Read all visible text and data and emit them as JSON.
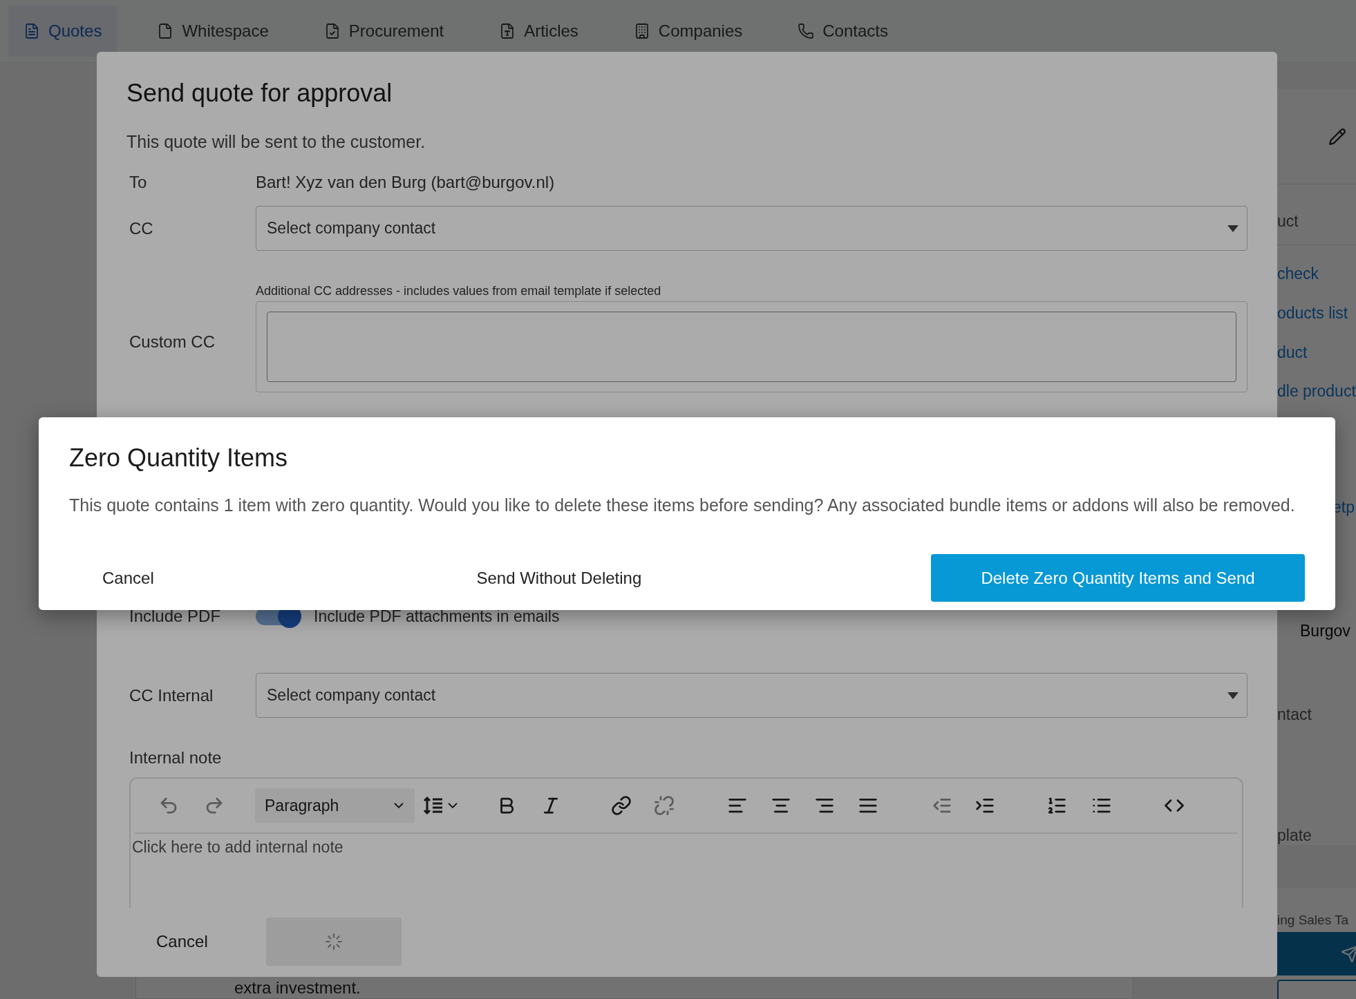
{
  "nav": {
    "tabs": [
      {
        "label": "Quotes",
        "selected": true
      },
      {
        "label": "Whitespace",
        "selected": false
      },
      {
        "label": "Procurement",
        "selected": false
      },
      {
        "label": "Articles",
        "selected": false
      },
      {
        "label": "Companies",
        "selected": false
      },
      {
        "label": "Contacts",
        "selected": false
      }
    ]
  },
  "side_panel": {
    "items": [
      {
        "kind": "text",
        "text": "uct"
      },
      {
        "kind": "link",
        "text": "check"
      },
      {
        "kind": "link",
        "text": "oducts list"
      },
      {
        "kind": "link",
        "text": "duct"
      },
      {
        "kind": "link",
        "text": "dle product"
      },
      {
        "kind": "link",
        "text": "etp"
      },
      {
        "kind": "value",
        "text": "Burgov"
      },
      {
        "kind": "label",
        "text": "ntact"
      },
      {
        "kind": "label",
        "text": "plate"
      }
    ],
    "footer_text": "ing Sales Ta"
  },
  "main_card": {
    "text": "extra investment."
  },
  "approval_dialog": {
    "title": "Send quote for approval",
    "description": "This quote will be sent to the customer.",
    "to": {
      "label": "To",
      "value": "Bart! Xyz van den Burg (bart@burgov.nl)"
    },
    "cc": {
      "label": "CC",
      "placeholder": "Select company contact"
    },
    "custom_cc": {
      "label": "Custom CC",
      "hint": "Additional CC addresses - includes values from email template if selected"
    },
    "include_pdf": {
      "label": "Include PDF",
      "text": "Include PDF attachments in emails",
      "on": true
    },
    "cc_internal": {
      "label": "CC Internal",
      "placeholder": "Select company contact"
    },
    "internal_note": {
      "label": "Internal note",
      "block_format": "Paragraph",
      "placeholder": "Click here to add internal note"
    },
    "footer": {
      "cancel": "Cancel",
      "submit_loading": true
    }
  },
  "zero_quantity_dialog": {
    "title": "Zero Quantity Items",
    "message": "This quote contains 1 item with zero quantity. Would you like to delete these items before sending? Any associated bundle items or addons will also be removed.",
    "buttons": [
      {
        "kind": "text",
        "label": "Cancel"
      },
      {
        "kind": "text",
        "label": "Send Without Deleting"
      },
      {
        "kind": "primary",
        "label": "Delete Zero Quantity Items and Send"
      }
    ]
  }
}
